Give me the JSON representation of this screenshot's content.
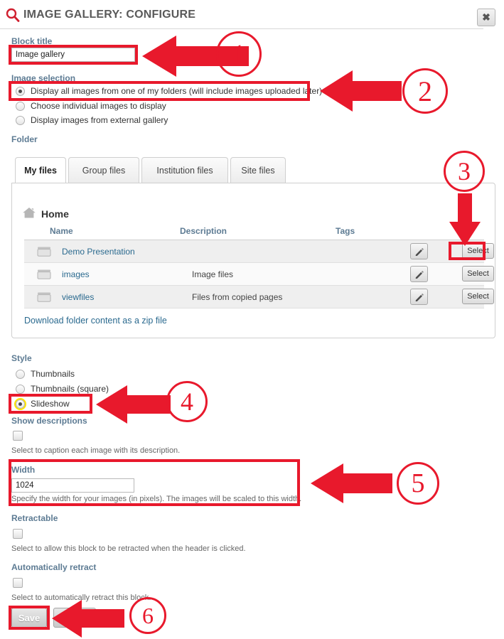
{
  "header": {
    "title": "IMAGE GALLERY: CONFIGURE",
    "search_icon": "magnifier-icon",
    "close_icon": "close-icon",
    "close_label": "✖"
  },
  "block_title": {
    "label": "Block title",
    "value": "Image gallery"
  },
  "image_selection": {
    "label": "Image selection",
    "options": [
      {
        "label": "Display all images from one of my folders (will include images uploaded later)",
        "checked": true
      },
      {
        "label": "Choose individual images to display",
        "checked": false
      },
      {
        "label": "Display images from external gallery",
        "checked": false
      }
    ]
  },
  "folder": {
    "label": "Folder",
    "tabs": [
      {
        "label": "My files",
        "active": true
      },
      {
        "label": "Group files",
        "active": false
      },
      {
        "label": "Institution files",
        "active": false
      },
      {
        "label": "Site files",
        "active": false
      }
    ],
    "home_label": "Home",
    "home_icon": "home-icon",
    "columns": [
      "Name",
      "Description",
      "Tags"
    ],
    "rows": [
      {
        "icon": "folder-icon",
        "name": "Demo Presentation",
        "description": "",
        "tags": "",
        "edit_icon": "pencil-icon",
        "select_label": "Select"
      },
      {
        "icon": "folder-icon",
        "name": "images",
        "description": "Image files",
        "tags": "",
        "edit_icon": "pencil-icon",
        "select_label": "Select"
      },
      {
        "icon": "folder-icon",
        "name": "viewfiles",
        "description": "Files from copied pages",
        "tags": "",
        "edit_icon": "pencil-icon",
        "select_label": "Select"
      }
    ],
    "download_link": "Download folder content as a zip file"
  },
  "style": {
    "label": "Style",
    "options": [
      {
        "label": "Thumbnails",
        "checked": false
      },
      {
        "label": "Thumbnails (square)",
        "checked": false
      },
      {
        "label": "Slideshow",
        "checked": true
      }
    ]
  },
  "show_descriptions": {
    "label": "Show descriptions",
    "checked": false,
    "help": "Select to caption each image with its description."
  },
  "width": {
    "label": "Width",
    "value": "1024",
    "help": "Specify the width for your images (in pixels). The images will be scaled to this width."
  },
  "retractable": {
    "label": "Retractable",
    "checked": false,
    "help": "Select to allow this block to be retracted when the header is clicked."
  },
  "auto_retract": {
    "label": "Automatically retract",
    "checked": false,
    "help": "Select to automatically retract this block."
  },
  "actions": {
    "save_label": "Save",
    "cancel_label": ""
  },
  "annotations": {
    "accent_color": "#e8192c",
    "highlight_color": "#ffe400",
    "steps": [
      "1",
      "2",
      "3",
      "4",
      "5",
      "6"
    ]
  }
}
